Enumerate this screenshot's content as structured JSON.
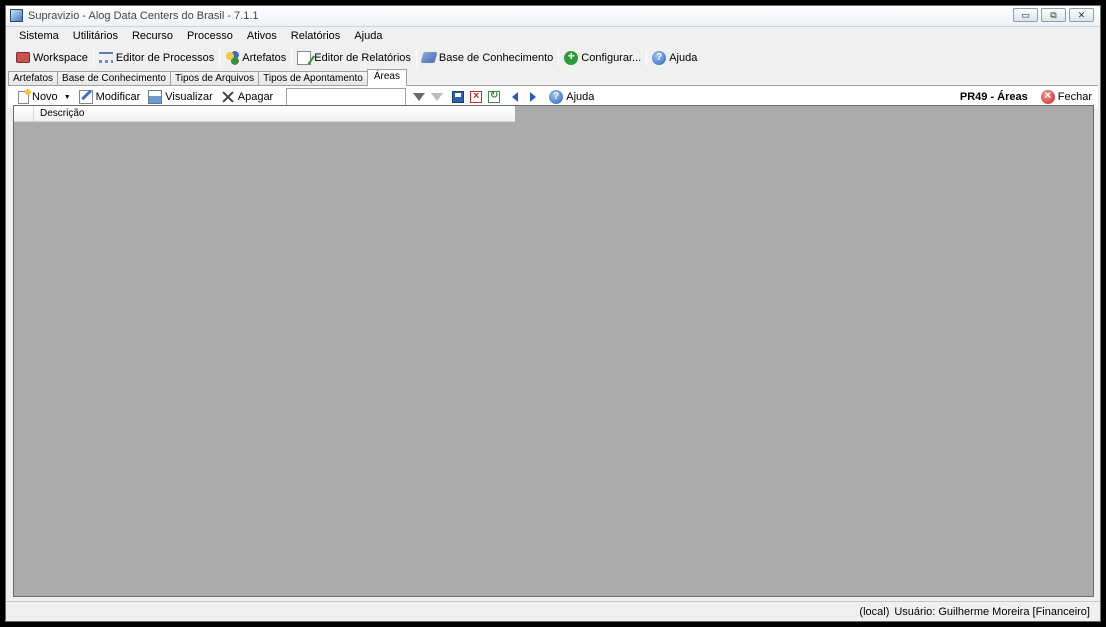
{
  "window": {
    "title": "Supravizio - Alog Data Centers do Brasil - 7.1.1",
    "controls": {
      "minimize": "▭",
      "restore": "⧉",
      "close": "✕"
    }
  },
  "menu": [
    "Sistema",
    "Utilitários",
    "Recurso",
    "Processo",
    "Ativos",
    "Relatórios",
    "Ajuda"
  ],
  "toolbar1": {
    "workspace": "Workspace",
    "process_editor": "Editor de Processos",
    "artifacts": "Artefatos",
    "report_editor": "Editor de Relatórios",
    "knowledge_base": "Base de Conhecimento",
    "configure": "Configurar...",
    "help": "Ajuda"
  },
  "tabs": [
    "Artefatos",
    "Base de Conhecimento",
    "Tipos de Arquivos",
    "Tipos de Apontamento",
    "Áreas"
  ],
  "toolbar2": {
    "new": "Novo",
    "modify": "Modificar",
    "view": "Visualizar",
    "delete": "Apagar",
    "search_value": "",
    "help": "Ajuda",
    "screen_title": "PR49 - Áreas",
    "close": "Fechar"
  },
  "grid": {
    "columns": [
      "Descrição"
    ]
  },
  "status": {
    "server": "(local)",
    "user": "Usuário: Guilherme Moreira [Financeiro]"
  },
  "icons": [
    "workspace-icon",
    "process-editor-icon",
    "artifacts-icon",
    "report-editor-icon",
    "knowledge-base-icon",
    "configure-icon",
    "help-icon",
    "new-icon",
    "modify-icon",
    "view-icon",
    "delete-icon",
    "filter-icon",
    "clear-filter-icon",
    "save-icon",
    "cancel-icon",
    "refresh-icon",
    "previous-icon",
    "next-icon",
    "close-icon"
  ]
}
